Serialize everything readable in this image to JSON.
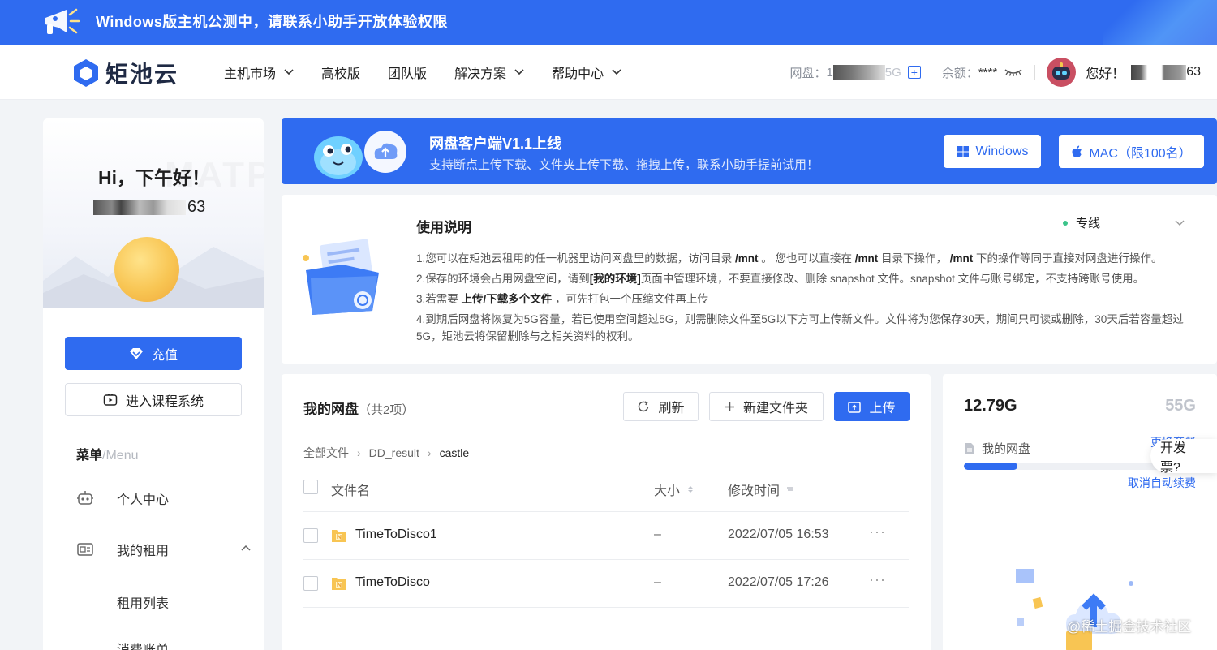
{
  "announcement": {
    "text": "Windows版主机公测中，请联系小助手开放体验权限"
  },
  "header": {
    "logo_text": "矩池云",
    "nav": [
      {
        "label": "主机市场",
        "has_dropdown": true
      },
      {
        "label": "高校版",
        "has_dropdown": false
      },
      {
        "label": "团队版",
        "has_dropdown": false
      },
      {
        "label": "解决方案",
        "has_dropdown": true
      },
      {
        "label": "帮助中心",
        "has_dropdown": true
      }
    ],
    "disk_label": "网盘：",
    "disk_value_prefix": "1",
    "disk_value_suffix": "5G",
    "balance_label": "余额：",
    "balance_value": "****",
    "greeting": "您好！",
    "user_suffix": "63"
  },
  "sidebar": {
    "bg_word": "MATP",
    "greeting": "Hi，下午好！",
    "user_suffix": "63",
    "recharge_label": "充值",
    "course_label": "进入课程系统",
    "menu_title": "菜单",
    "menu_title_en": "/Menu",
    "menu_items": [
      {
        "label": "个人中心",
        "icon": "robot-icon"
      },
      {
        "label": "我的租用",
        "icon": "server-icon",
        "expanded": true
      }
    ],
    "sub_items": [
      "租用列表",
      "消费账单"
    ]
  },
  "promo": {
    "title": "网盘客户端V1.1上线",
    "subtitle": "支持断点上传下载、文件夹上传下载、拖拽上传，联系小助手提前试用！",
    "windows_label": "Windows",
    "mac_label": "MAC（限100名）"
  },
  "instructions": {
    "title": "使用说明",
    "region": "专线",
    "line1_a": "1.您可以在矩池云租用的任一机器里访问网盘里的数据，访问目录 ",
    "line1_b": "/mnt",
    "line1_c": " 。 您也可以直接在 ",
    "line1_d": "/mnt",
    "line1_e": " 目录下操作， ",
    "line1_f": "/mnt",
    "line1_g": " 下的操作等同于直接对网盘进行操作。",
    "line2_a": "2.保存的环境会占用网盘空间，请到",
    "line2_b": "[我的环境]",
    "line2_c": "页面中管理环境，不要直接修改、删除 snapshot 文件。snapshot 文件与账号绑定，不支持跨账号使用。",
    "line3_a": "3.若需要 ",
    "line3_b": "上传/下载多个文件",
    "line3_c": " ，可先打包一个压缩文件再上传",
    "line4": "4.到期后网盘将恢复为5G容量，若已使用空间超过5G，则需删除文件至5G以下方可上传新文件。文件将为您保存30天，期间只可读或删除，30天后若容量超过5G，矩池云将保留删除与之相关资料的权利。"
  },
  "disk": {
    "title": "我的网盘",
    "count": "（共2项）",
    "refresh_label": "刷新",
    "new_folder_label": "新建文件夹",
    "upload_label": "上传",
    "breadcrumb": [
      "全部文件",
      "DD_result",
      "castle"
    ],
    "columns": {
      "name": "文件名",
      "size": "大小",
      "modified": "修改时间"
    },
    "files": [
      {
        "name": "TimeToDisco1",
        "size": "–",
        "modified": "2022/07/05 16:53"
      },
      {
        "name": "TimeToDisco",
        "size": "–",
        "modified": "2022/07/05 17:26"
      }
    ]
  },
  "quota": {
    "used": "12.79G",
    "total": "55G",
    "my_disk_label": "我的网盘",
    "change_label": "更换套餐",
    "cancel_renew_label": "取消自动续费",
    "used_fraction": 0.23
  },
  "invoice_label": "开发票?",
  "watermark": "@稀土掘金技术社区",
  "colors": {
    "primary": "#2f6bf0",
    "accent_green": "#3bc48a"
  }
}
